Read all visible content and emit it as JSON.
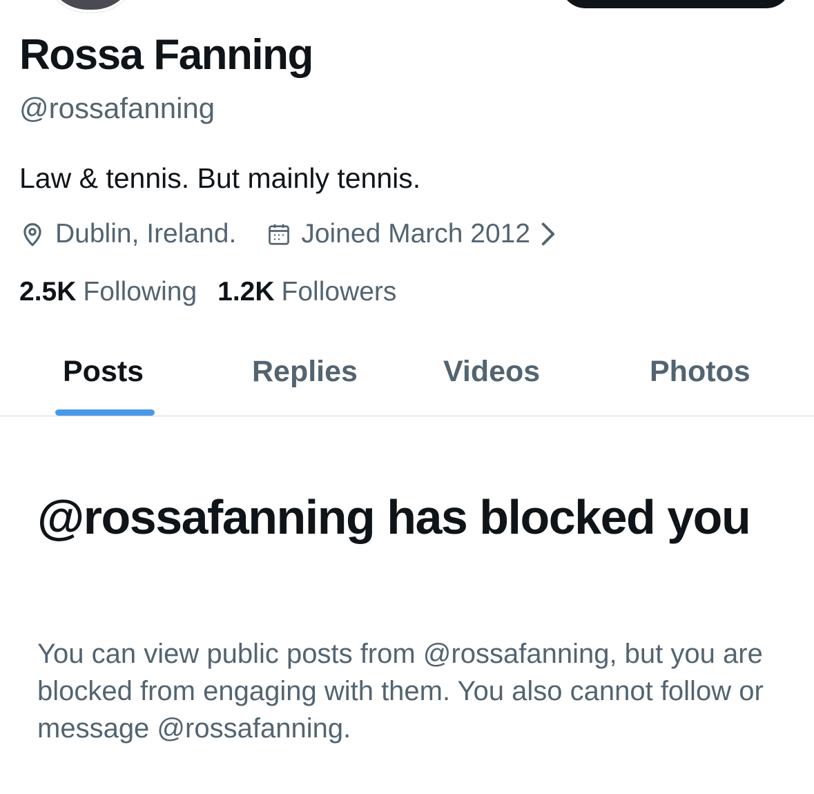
{
  "profile": {
    "display_name": "Rossa Fanning",
    "handle": "@rossafanning",
    "bio": "Law & tennis. But mainly tennis.",
    "location": "Dublin, Ireland.",
    "joined": "Joined March 2012",
    "following_count": "2.5K",
    "following_label": "Following",
    "followers_count": "1.2K",
    "followers_label": "Followers"
  },
  "tabs": [
    {
      "label": "Posts",
      "active": true
    },
    {
      "label": "Replies",
      "active": false
    },
    {
      "label": "Videos",
      "active": false
    },
    {
      "label": "Photos",
      "active": false
    }
  ],
  "blocked": {
    "title": "@rossafanning has blocked you",
    "description": "You can view public posts from @rossafanning, but you are blocked from engaging with them. You also cannot follow or message @rossafanning."
  },
  "icons": {
    "location": "location-pin-icon",
    "joined": "calendar-icon",
    "joined_more": "chevron-right-icon"
  },
  "colors": {
    "primary_text": "#0f1419",
    "secondary_text": "#536471",
    "accent": "#4a99e9",
    "divider": "#cfd9de"
  }
}
